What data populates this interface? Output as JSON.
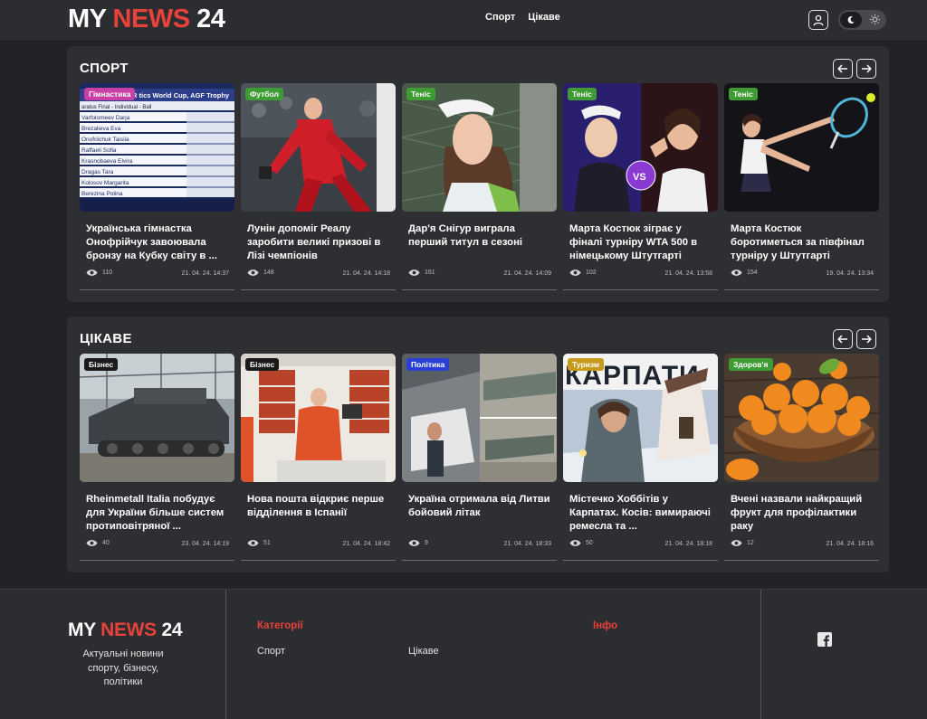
{
  "header": {
    "logo_part1": "MY",
    "logo_part2": "NEWS",
    "logo_part3": "24",
    "nav": [
      "Спорт",
      "Цікаве"
    ]
  },
  "sections": [
    {
      "title": "СПОРТ",
      "cards": [
        {
          "badge": "Гімнастика",
          "badge_color": "#c93fa3",
          "title": "Українська гімнастка Онофрійчук завоювала бронзу на Кубку світу в ...",
          "views": "110",
          "date": "21. 04. 24. 14:37"
        },
        {
          "badge": "Футбол",
          "badge_color": "#3f9c35",
          "title": "Лунін допоміг Реалу заробити великі призові в Лізі чемпіонів",
          "views": "148",
          "date": "21. 04. 24. 14:18"
        },
        {
          "badge": "Теніс",
          "badge_color": "#3f9c35",
          "title": "Дар'я Снігур виграла перший титул в сезоні",
          "views": "161",
          "date": "21. 04. 24. 14:09"
        },
        {
          "badge": "Теніс",
          "badge_color": "#3f9c35",
          "title": "Марта Костюк зіграє у фіналі турніру WTA 500 в німецькому Штутгарті",
          "views": "102",
          "date": "21. 04. 24. 13:58"
        },
        {
          "badge": "Теніс",
          "badge_color": "#3f9c35",
          "title": "Марта Костюк боротиметься за півфінал турніру у Штутгарті",
          "views": "154",
          "date": "19. 04. 24. 13:34"
        }
      ]
    },
    {
      "title": "ЦІКАВЕ",
      "cards": [
        {
          "badge": "Бізнес",
          "badge_color": "#1a1a1a",
          "title": "Rheinmetall Italia побудує для України більше систем протиповітряної ...",
          "views": "40",
          "date": "23. 04. 24. 14:19"
        },
        {
          "badge": "Бізнес",
          "badge_color": "#1a1a1a",
          "title": "Нова пошта відкриє перше відділення в Іспанії",
          "views": "51",
          "date": "21. 04. 24. 18:42"
        },
        {
          "badge": "Політика",
          "badge_color": "#2a3fd6",
          "title": "Україна отримала від Литви бойовий літак",
          "views": "9",
          "date": "21. 04. 24. 18:33"
        },
        {
          "badge": "Туризм",
          "badge_color": "#c79a1c",
          "title": "Містечко Хоббітів у Карпатах. Косів: вимираючі ремесла та ...",
          "views": "50",
          "date": "21. 04. 24. 18:18"
        },
        {
          "badge": "Здоров'я",
          "badge_color": "#3f9c35",
          "title": "Вчені назвали найкращий фрукт для профілактики раку",
          "views": "12",
          "date": "21. 04. 24. 18:16"
        }
      ]
    }
  ],
  "image_texts": {
    "gym_header": "R     tics World Cup, AGF Trophy",
    "gym_sub": "aratus Final - Individual - Ball",
    "gym_names": [
      "Varfolomeev Darja",
      "Brezalieva Eva",
      "Onofriichuk Taisiia",
      "Raffaeli Sofia",
      "Krasnobaeva Elvira",
      "Dragas Tara",
      "Kolosov Margarita",
      "Berezina Polina"
    ],
    "vs": "VS",
    "karpaty": "КАРПАТИ"
  },
  "footer": {
    "logo_part1": "MY",
    "logo_part2": "NEWS",
    "logo_part3": "24",
    "description": "Актуальні новини спорту, бізнесу, політики",
    "categories_title": "Категорії",
    "info_title": "Інфо",
    "links": [
      "Спорт",
      "Цікаве"
    ]
  },
  "colors": {
    "accent": "#e8423a",
    "background": "#222326",
    "panel": "#2e2f33"
  },
  "icons": [
    "user-icon",
    "moon-icon",
    "sun-icon",
    "arrow-left-icon",
    "arrow-right-icon",
    "eye-icon",
    "facebook-icon"
  ]
}
